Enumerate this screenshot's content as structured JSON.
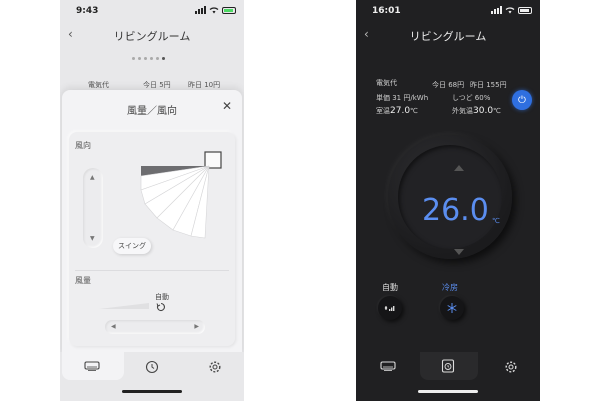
{
  "light": {
    "status_time": "9:43",
    "title": "リビングルーム",
    "peek": {
      "electricity": "電気代",
      "today": "今日 5円",
      "yesterday": "昨日 10円"
    },
    "sheet": {
      "title": "風量／風向",
      "direction_label": "風向",
      "swing_label": "スイング",
      "volume_label": "風量",
      "auto_label": "自動"
    }
  },
  "dark": {
    "status_time": "16:01",
    "title": "リビングルーム",
    "info": {
      "electricity_label": "電気代",
      "today": "今日 68円",
      "yesterday": "昨日 155円",
      "unit_price": "単価 31 円/kWh",
      "humidity": "しつど 60%",
      "room_temp_label": "室温",
      "room_temp": "27.0",
      "outdoor_temp_label": "外気温",
      "outdoor_temp": "30.0",
      "temp_unit": "℃"
    },
    "set_temp": "26.0",
    "set_temp_unit": "℃",
    "mode_auto_label": "自動",
    "mode_cool_label": "冷房",
    "accent_color": "#5b8ef0",
    "power_color": "#2f6fe0"
  },
  "icons": {
    "back": "‹",
    "close": "✕",
    "arrow_up": "▲",
    "arrow_down": "▼",
    "arrow_left": "◀",
    "arrow_right": "▶",
    "power": "⏻"
  }
}
